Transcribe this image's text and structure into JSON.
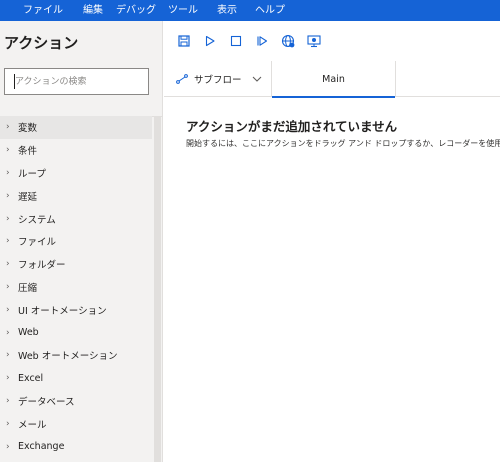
{
  "menu": {
    "items": [
      {
        "label": "ファイル"
      },
      {
        "label": "編集"
      },
      {
        "label": "デバッグ"
      },
      {
        "label": "ツール"
      },
      {
        "label": "表示"
      },
      {
        "label": "ヘルプ"
      }
    ]
  },
  "sidebar": {
    "title": "アクション",
    "search_placeholder": "アクションの検索",
    "items": [
      {
        "label": "変数"
      },
      {
        "label": "条件"
      },
      {
        "label": "ループ"
      },
      {
        "label": "遅延"
      },
      {
        "label": "システム"
      },
      {
        "label": "ファイル"
      },
      {
        "label": "フォルダー"
      },
      {
        "label": "圧縮"
      },
      {
        "label": "UI オートメーション"
      },
      {
        "label": "Web"
      },
      {
        "label": "Web オートメーション"
      },
      {
        "label": "Excel"
      },
      {
        "label": "データベース"
      },
      {
        "label": "メール"
      },
      {
        "label": "Exchange"
      }
    ]
  },
  "toolbar": {
    "buttons": [
      "save-icon",
      "run-icon",
      "stop-icon",
      "next-action-icon",
      "web-recorder-icon",
      "desktop-recorder-icon"
    ],
    "icon_color": "#1563d6"
  },
  "tabs": {
    "subflow_label": "サブフロー",
    "main_label": "Main"
  },
  "editor": {
    "empty_heading": "アクションがまだ追加されていません",
    "empty_description": "開始するには、ここにアクションをドラッグ アンド ドロップするか、レコーダーを使用"
  },
  "colors": {
    "accent": "#1563d6",
    "sidebar_bg": "#f3f2f1"
  }
}
